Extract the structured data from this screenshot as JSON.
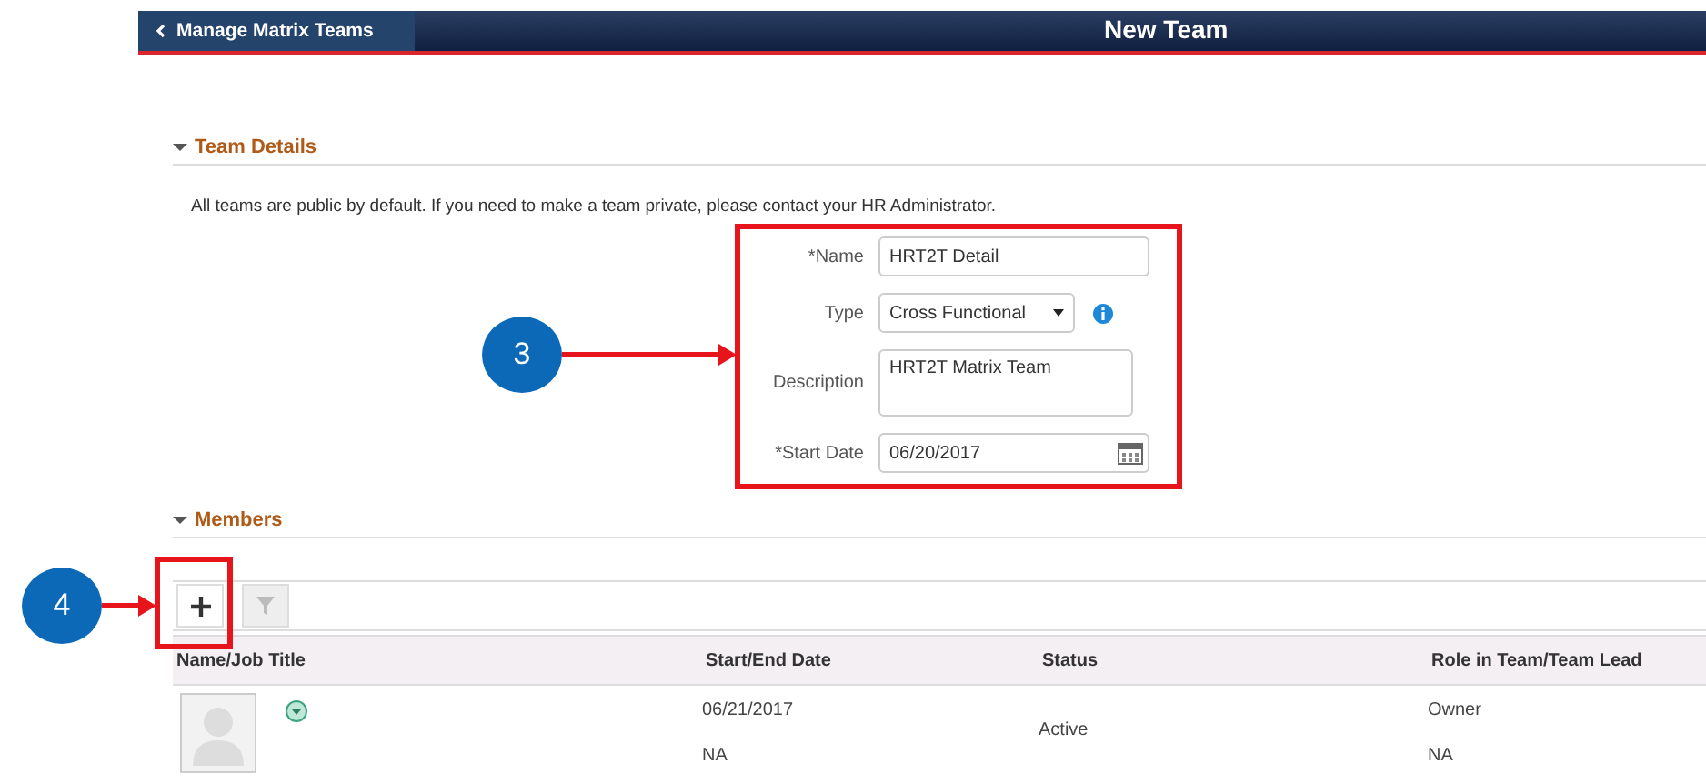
{
  "header": {
    "back_button": "Manage Matrix Teams",
    "title": "New Team"
  },
  "team_details": {
    "heading": "Team Details",
    "expanded": true,
    "notice": "All teams are public by default. If you need to make a team private, please contact your HR Administrator.",
    "fields": [
      {
        "kind": "text",
        "label": "*Name",
        "value": "HRT2T Detail"
      },
      {
        "kind": "select",
        "label": "Type",
        "value": "Cross Functional"
      },
      {
        "kind": "textarea",
        "label": "Description",
        "value": "HRT2T Matrix Team"
      },
      {
        "kind": "date",
        "label": "*Start Date",
        "value": "06/20/2017"
      }
    ]
  },
  "members": {
    "heading": "Members",
    "expanded": true,
    "toolbar": [
      {
        "kind": "add",
        "disabled": false
      },
      {
        "kind": "filter",
        "disabled": true
      }
    ],
    "columns": [
      "Name/Job Title",
      "Start/End Date",
      "Status",
      "Role in Team/Team Lead"
    ],
    "rows": [
      {
        "start_date": "06/21/2017",
        "end_date": "NA",
        "status": "Active",
        "role": "Owner",
        "team_lead": "NA"
      }
    ]
  },
  "annotations": [
    {
      "label": "3"
    },
    {
      "label": "4"
    }
  ]
}
